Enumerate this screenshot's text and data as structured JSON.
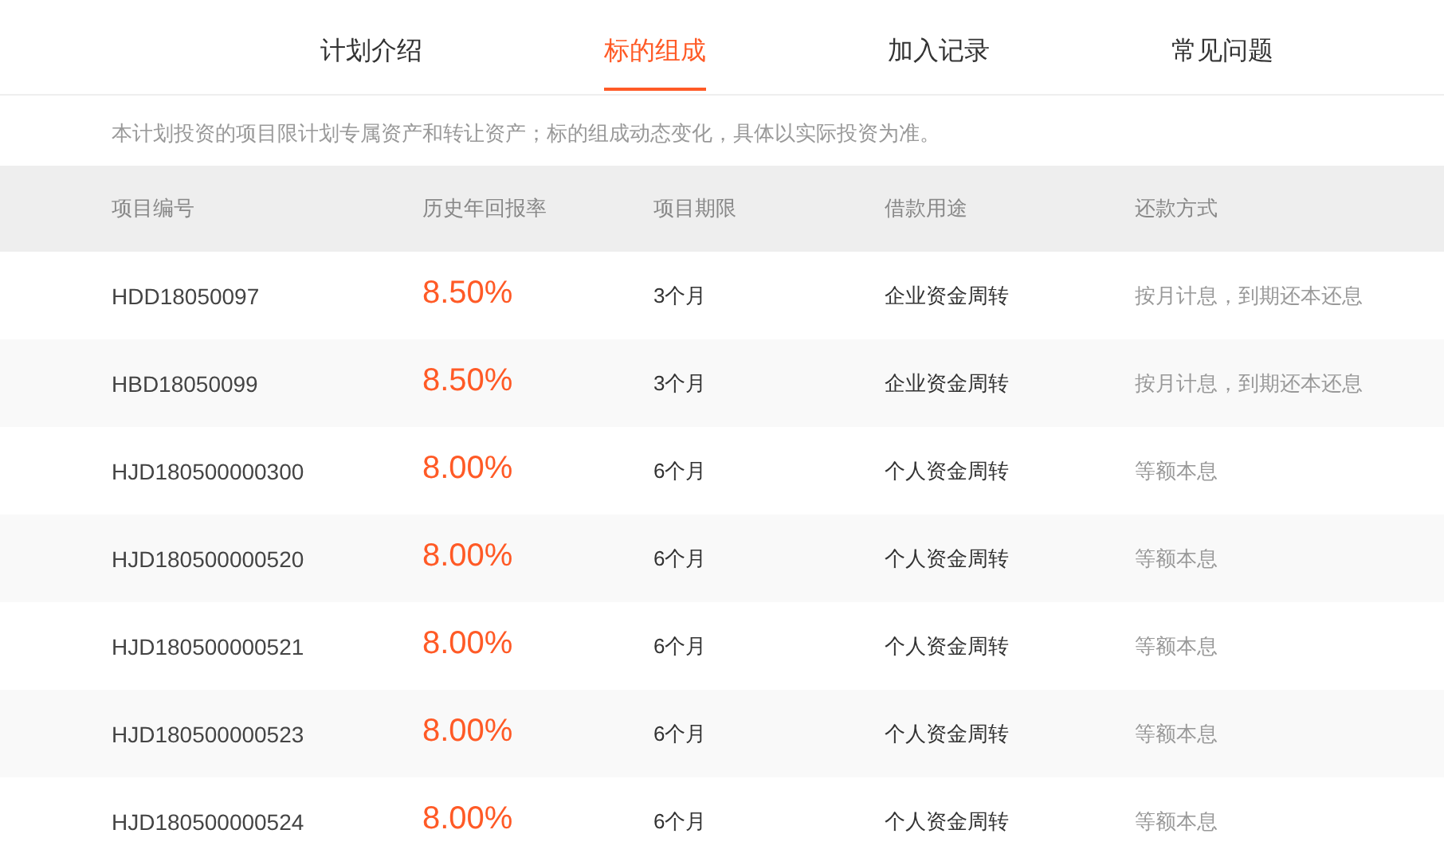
{
  "tabs": [
    {
      "label": "计划介绍",
      "selected": false
    },
    {
      "label": "标的组成",
      "selected": true
    },
    {
      "label": "加入记录",
      "selected": false
    },
    {
      "label": "常见问题",
      "selected": false
    }
  ],
  "note": "本计划投资的项目限计划专属资产和转让资产；标的组成动态变化，具体以实际投资为准。",
  "table": {
    "columns": [
      "项目编号",
      "历史年回报率",
      "项目期限",
      "借款用途",
      "还款方式"
    ],
    "rows": [
      [
        "HDD18050097",
        "8.50%",
        "3个月",
        "企业资金周转",
        "按月计息，到期还本还息"
      ],
      [
        "HBD18050099",
        "8.50%",
        "3个月",
        "企业资金周转",
        "按月计息，到期还本还息"
      ],
      [
        "HJD180500000300",
        "8.00%",
        "6个月",
        "个人资金周转",
        "等额本息"
      ],
      [
        "HJD180500000520",
        "8.00%",
        "6个月",
        "个人资金周转",
        "等额本息"
      ],
      [
        "HJD180500000521",
        "8.00%",
        "6个月",
        "个人资金周转",
        "等额本息"
      ],
      [
        "HJD180500000523",
        "8.00%",
        "6个月",
        "个人资金周转",
        "等额本息"
      ],
      [
        "HJD180500000524",
        "8.00%",
        "6个月",
        "个人资金周转",
        "等额本息"
      ]
    ]
  }
}
